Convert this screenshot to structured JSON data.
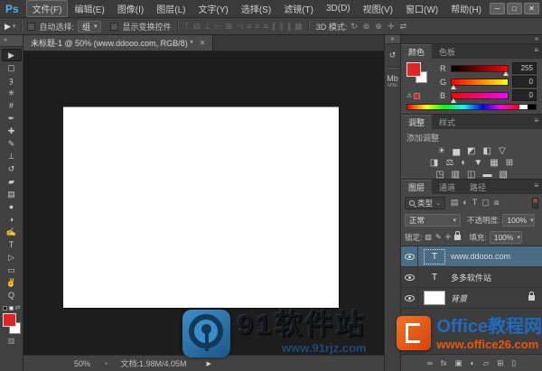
{
  "app": {
    "logo": "Ps"
  },
  "window_controls": {
    "minimize": "─",
    "maximize": "□",
    "close": "✕"
  },
  "menu": {
    "items": [
      {
        "label": "文件(F)",
        "selected": true
      },
      {
        "label": "编辑(E)"
      },
      {
        "label": "图像(I)"
      },
      {
        "label": "图层(L)"
      },
      {
        "label": "文字(Y)"
      },
      {
        "label": "选择(S)"
      },
      {
        "label": "滤镜(T)"
      },
      {
        "label": "3D(D)"
      },
      {
        "label": "视图(V)"
      },
      {
        "label": "窗口(W)"
      },
      {
        "label": "帮助(H)"
      }
    ]
  },
  "options_bar": {
    "tool_glyph": "▶",
    "tool_dropdown": "▾",
    "auto_select_label": "自动选择:",
    "auto_select_value": "组",
    "dropdown_arrow": "▾",
    "show_transform_label": "显示变换控件",
    "align_icons": [
      {
        "name": "align-top-icon",
        "glyph": "⊤"
      },
      {
        "name": "align-vcenter-icon",
        "glyph": "⊟"
      },
      {
        "name": "align-bottom-icon",
        "glyph": "⊥"
      },
      {
        "name": "align-left-icon",
        "glyph": "⊢"
      },
      {
        "name": "align-hcenter-icon",
        "glyph": "⊞"
      },
      {
        "name": "align-right-icon",
        "glyph": "⊣"
      },
      {
        "name": "distribute-top-icon",
        "glyph": "≡"
      },
      {
        "name": "distribute-vcenter-icon",
        "glyph": "≡"
      },
      {
        "name": "distribute-bottom-icon",
        "glyph": "≡"
      },
      {
        "name": "distribute-left-icon",
        "glyph": "∥"
      },
      {
        "name": "distribute-hcenter-icon",
        "glyph": "∥"
      },
      {
        "name": "distribute-right-icon",
        "glyph": "∥"
      },
      {
        "name": "auto-align-icon",
        "glyph": "▦"
      }
    ],
    "mode_3d_label": "3D 模式:",
    "mode_3d_icons": [
      {
        "name": "3d-orbit-icon",
        "glyph": "↻"
      },
      {
        "name": "3d-roll-icon",
        "glyph": "⊚"
      },
      {
        "name": "3d-pan-icon",
        "glyph": "⊕"
      },
      {
        "name": "3d-slide-icon",
        "glyph": "✛"
      },
      {
        "name": "3d-scale-icon",
        "glyph": "⇄"
      }
    ]
  },
  "doc_tab": {
    "title": "未标题-1 @ 50% (www.ddooo.com, RGB/8) *",
    "close": "✕"
  },
  "toolbar": {
    "collapse": "»",
    "tools": [
      {
        "name": "move-tool",
        "glyph": "▶",
        "selected": true
      },
      {
        "name": "rectangular-marquee-tool",
        "glyph": "▢"
      },
      {
        "name": "lasso-tool",
        "glyph": "ȝ"
      },
      {
        "name": "quick-selection-tool",
        "glyph": "✳"
      },
      {
        "name": "crop-tool",
        "glyph": "#"
      },
      {
        "name": "eyedropper-tool",
        "glyph": "✒"
      },
      {
        "name": "spot-healing-brush-tool",
        "glyph": "✚"
      },
      {
        "name": "brush-tool",
        "glyph": "✎"
      },
      {
        "name": "clone-stamp-tool",
        "glyph": "⊥"
      },
      {
        "name": "history-brush-tool",
        "glyph": "↺"
      },
      {
        "name": "eraser-tool",
        "glyph": "▰"
      },
      {
        "name": "gradient-tool",
        "glyph": "▤"
      },
      {
        "name": "blur-tool",
        "glyph": "●"
      },
      {
        "name": "dodge-tool",
        "glyph": "◑"
      },
      {
        "name": "pen-tool",
        "glyph": "✍"
      },
      {
        "name": "type-tool",
        "glyph": "T"
      },
      {
        "name": "path-selection-tool",
        "glyph": "▷"
      },
      {
        "name": "rectangle-tool",
        "glyph": "▭"
      },
      {
        "name": "hand-tool",
        "glyph": "✌"
      },
      {
        "name": "zoom-tool",
        "glyph": "Q"
      }
    ],
    "swap_glyph": "⇄",
    "bottom_glyph": "▥"
  },
  "dock": {
    "collapse": "»",
    "history_glyph": "↺",
    "mini_bridge_glyph": "Mb",
    "mini_bridge_caption": "MINI"
  },
  "color_panel": {
    "tabs": [
      {
        "label": "颜色",
        "selected": true
      },
      {
        "label": "色板"
      }
    ],
    "menu_icon": "≡",
    "gamut_warning": "⚠",
    "channels": [
      {
        "label": "R",
        "value": "255",
        "handle_style": "left:96%"
      },
      {
        "label": "G",
        "value": "0",
        "handle_style": "left:4%"
      },
      {
        "label": "B",
        "value": "0",
        "handle_style": "left:4%"
      }
    ]
  },
  "adjustments_panel": {
    "tabs": [
      {
        "label": "调整",
        "selected": true
      },
      {
        "label": "样式"
      }
    ],
    "menu_icon": "≡",
    "add_label": "添加调整",
    "row1": [
      {
        "name": "brightness-contrast-icon",
        "glyph": "☀"
      },
      {
        "name": "levels-icon",
        "glyph": "▅"
      },
      {
        "name": "curves-icon",
        "glyph": "◩"
      },
      {
        "name": "exposure-icon",
        "glyph": "◧"
      },
      {
        "name": "vibrance-icon",
        "glyph": "▽"
      }
    ],
    "row2": [
      {
        "name": "hue-saturation-icon",
        "glyph": "◨"
      },
      {
        "name": "color-balance-icon",
        "glyph": "⚖"
      },
      {
        "name": "black-white-icon",
        "glyph": "◐"
      },
      {
        "name": "photo-filter-icon",
        "glyph": "▼"
      },
      {
        "name": "channel-mixer-icon",
        "glyph": "▦"
      },
      {
        "name": "color-lookup-icon",
        "glyph": "⊞"
      }
    ],
    "row3": [
      {
        "name": "invert-icon",
        "glyph": "◳"
      },
      {
        "name": "posterize-icon",
        "glyph": "▥"
      },
      {
        "name": "threshold-icon",
        "glyph": "◫"
      },
      {
        "name": "gradient-map-icon",
        "glyph": "▬"
      },
      {
        "name": "selective-color-icon",
        "glyph": "▧"
      }
    ]
  },
  "layers_panel": {
    "tabs": [
      {
        "label": "图层",
        "selected": true
      },
      {
        "label": "通道"
      },
      {
        "label": "路径"
      }
    ],
    "menu_icon": "≡",
    "filter": {
      "kind_label": "类型",
      "kind_arrow": "⌄",
      "icons": [
        {
          "name": "filter-pixel-layers-icon",
          "glyph": "▤"
        },
        {
          "name": "filter-adjustment-layers-icon",
          "glyph": "◐"
        },
        {
          "name": "filter-type-layers-icon",
          "glyph": "T"
        },
        {
          "name": "filter-shape-layers-icon",
          "glyph": "▢"
        },
        {
          "name": "filter-smart-objects-icon",
          "glyph": "⧈"
        }
      ]
    },
    "blend_mode": "正常",
    "opacity_label": "不透明度:",
    "opacity_value": "100%",
    "lock_label": "锁定:",
    "lock_icons": [
      {
        "name": "lock-transparent-pixels-icon",
        "glyph": "▨"
      },
      {
        "name": "lock-image-pixels-icon",
        "glyph": "✎"
      },
      {
        "name": "lock-position-icon",
        "glyph": "✛"
      }
    ],
    "fill_label": "填充:",
    "fill_value": "100%",
    "layers": [
      {
        "name": "www.ddooo.com",
        "type": "text",
        "selected": true,
        "thumb": "T"
      },
      {
        "name": "多多软件站",
        "type": "text",
        "selected": false,
        "thumb": "T"
      },
      {
        "name": "背景",
        "type": "background",
        "selected": false,
        "locked": true
      }
    ],
    "bottom_icons": [
      {
        "name": "link-layers-icon",
        "glyph": "∞"
      },
      {
        "name": "layer-style-icon",
        "glyph": "fx"
      },
      {
        "name": "add-layer-mask-icon",
        "glyph": "▣"
      },
      {
        "name": "new-adjustment-layer-icon",
        "glyph": "◐"
      },
      {
        "name": "new-group-icon",
        "glyph": "▱"
      },
      {
        "name": "new-layer-icon",
        "glyph": "⊞"
      },
      {
        "name": "delete-layer-icon",
        "glyph": "▯"
      }
    ]
  },
  "status_bar": {
    "zoom_value": "50%",
    "circle_icon": "◔",
    "doc_info": "文档:1.98M/4.05M",
    "expand_icon": "▶"
  },
  "watermarks": {
    "center": {
      "title": "91软件站",
      "url": "www.91rjz.com"
    },
    "right": {
      "title": "Office教程网",
      "url": "www.office26.com"
    }
  },
  "colors": {
    "foreground_red": "#e32424",
    "selection_blue": "#4a6c84",
    "ps_logo_blue": "#4fb2f2",
    "office_orange": "#e8580c",
    "office_blue": "#1e6bbf",
    "watermark91_blue": "#2f7fb8"
  }
}
